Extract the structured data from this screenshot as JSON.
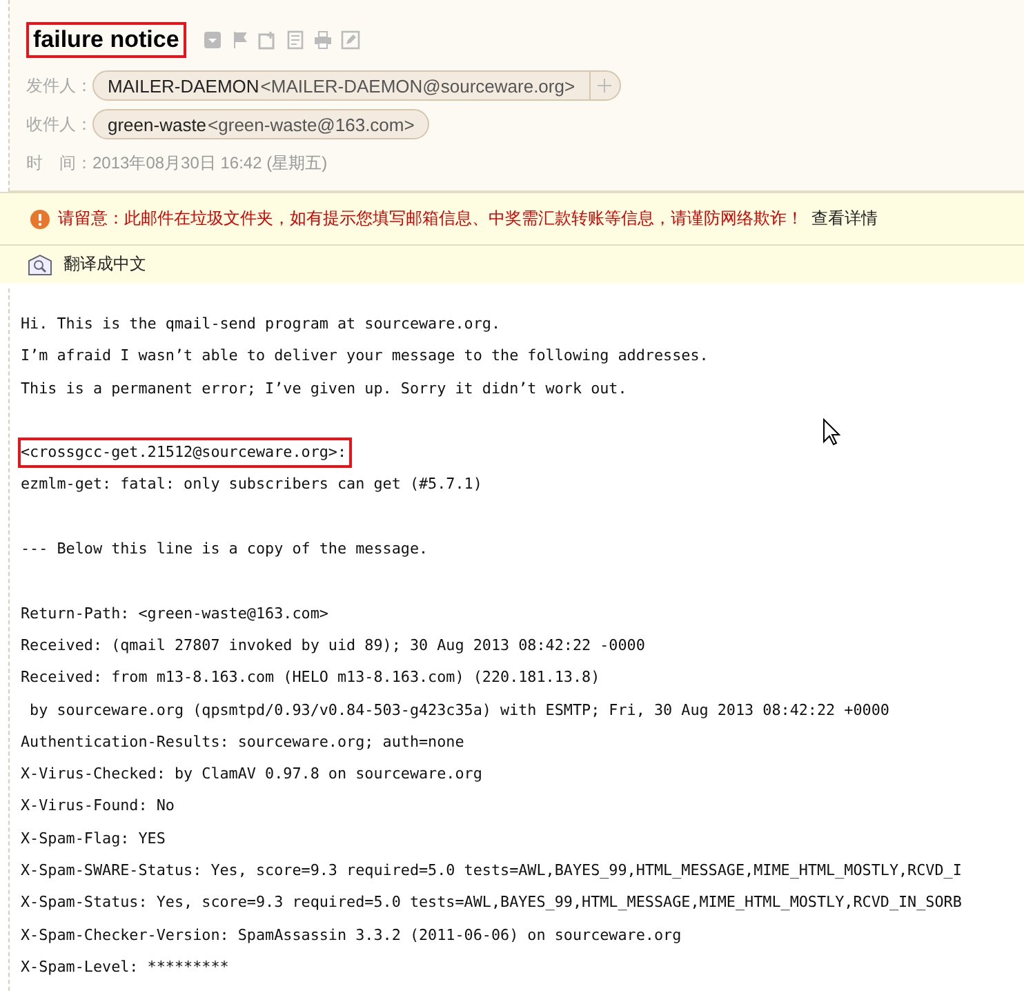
{
  "header": {
    "title": "failure notice",
    "title_highlighted": true,
    "fields": [
      {
        "label": "发件人：",
        "name": "MAILER-DAEMON",
        "address": "<MAILER-DAEMON@sourceware.org>",
        "addable": true
      },
      {
        "label": "收件人：",
        "name": "green-waste",
        "address": "<green-waste@163.com>",
        "addable": false
      }
    ],
    "time_label": "时　间：",
    "time": "2013年08月30日 16:42 (星期五)"
  },
  "warning": {
    "text": "请留意：此邮件在垃圾文件夹，如有提示您填写邮箱信息、中奖需汇款转账等信息，请谨防网络欺诈！",
    "link": "查看详情"
  },
  "translate": {
    "label": "翻译成中文"
  },
  "body": {
    "lines": [
      {
        "kind": "text",
        "text": "Hi. This is the qmail-send program at sourceware.org."
      },
      {
        "kind": "text",
        "text": "I’m afraid I wasn’t able to deliver your message to the following addresses."
      },
      {
        "kind": "text",
        "text": "This is a permanent error; I’ve given up. Sorry it didn’t work out."
      },
      {
        "kind": "blank"
      },
      {
        "kind": "highlighted",
        "text": "<crossgcc-get.21512@sourceware.org>:"
      },
      {
        "kind": "text",
        "text": "ezmlm-get: fatal: only subscribers can get (#5.7.1)"
      },
      {
        "kind": "blank"
      },
      {
        "kind": "text",
        "text": "--- Below this line is a copy of the message."
      },
      {
        "kind": "blank"
      },
      {
        "kind": "text",
        "text": "Return-Path: <green-waste@163.com>"
      },
      {
        "kind": "text",
        "text": "Received: (qmail 27807 invoked by uid 89); 30 Aug 2013 08:42:22 -0000"
      },
      {
        "kind": "text",
        "text": "Received: from m13-8.163.com (HELO m13-8.163.com) (220.181.13.8)"
      },
      {
        "kind": "text",
        "text": " by sourceware.org (qpsmtpd/0.93/v0.84-503-g423c35a) with ESMTP; Fri, 30 Aug 2013 08:42:22 +0000"
      },
      {
        "kind": "text",
        "text": "Authentication-Results: sourceware.org; auth=none"
      },
      {
        "kind": "text",
        "text": "X-Virus-Checked: by ClamAV 0.97.8 on sourceware.org"
      },
      {
        "kind": "text",
        "text": "X-Virus-Found: No"
      },
      {
        "kind": "text",
        "text": "X-Spam-Flag: YES"
      },
      {
        "kind": "text",
        "text": "X-Spam-SWARE-Status: Yes, score=9.3 required=5.0 tests=AWL,BAYES_99,HTML_MESSAGE,MIME_HTML_MOSTLY,RCVD_I"
      },
      {
        "kind": "text",
        "text": "X-Spam-Status: Yes, score=9.3 required=5.0 tests=AWL,BAYES_99,HTML_MESSAGE,MIME_HTML_MOSTLY,RCVD_IN_SORB"
      },
      {
        "kind": "text",
        "text": "X-Spam-Checker-Version: SpamAssassin 3.3.2 (2011-06-06) on sourceware.org"
      },
      {
        "kind": "text",
        "text": "X-Spam-Level: *********"
      }
    ]
  }
}
